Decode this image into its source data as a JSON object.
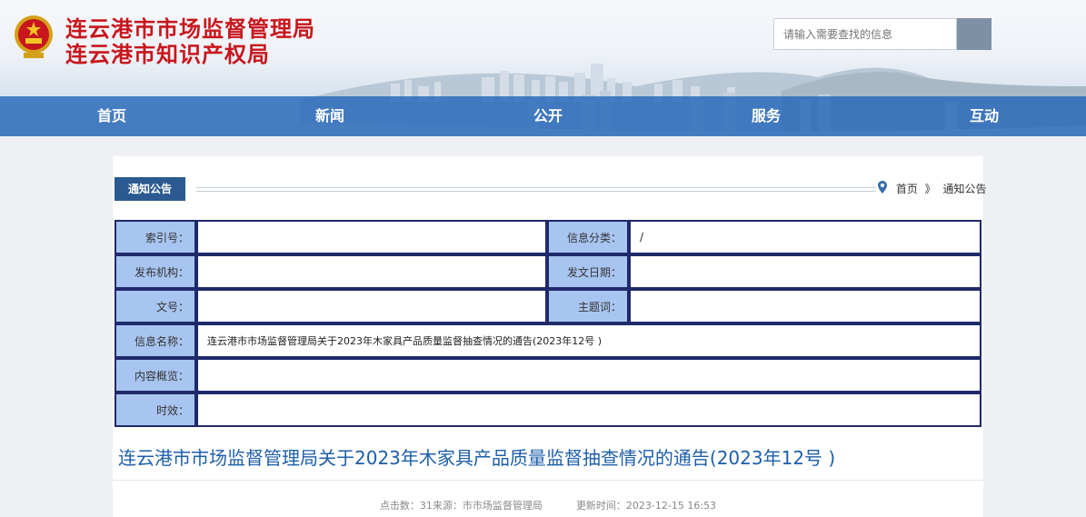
{
  "header": {
    "org_name_1": "连云港市市场监督管理局",
    "org_name_2": "连云港市知识产权局",
    "search_placeholder": "请输入需要查找的信息"
  },
  "nav": {
    "items": [
      {
        "label": "首页"
      },
      {
        "label": "新闻"
      },
      {
        "label": "公开"
      },
      {
        "label": "服务"
      },
      {
        "label": "互动"
      }
    ]
  },
  "section": {
    "tag": "通知公告",
    "breadcrumb": {
      "home": "首页",
      "separator": "》",
      "current": "通知公告"
    }
  },
  "meta": {
    "index_no_label": "索引号：",
    "index_no_value": "",
    "category_label": "信息分类：",
    "category_value": "/",
    "publisher_label": "发布机构：",
    "publisher_value": "",
    "issue_date_label": "发文日期：",
    "issue_date_value": "",
    "doc_no_label": "文号：",
    "doc_no_value": "",
    "keywords_label": "主题词：",
    "keywords_value": "",
    "info_name_label": "信息名称：",
    "info_name_value": "连云港市市场监督管理局关于2023年木家具产品质量监督抽查情况的通告(2023年12号 )",
    "summary_label": "内容概览：",
    "summary_value": "",
    "validity_label": "时效：",
    "validity_value": ""
  },
  "article": {
    "title": "连云港市市场监督管理局关于2023年木家具产品质量监督抽查情况的通告(2023年12号 )",
    "clicks_source": "点击数：31来源：市市场监督管理局",
    "updated": "更新时间：2023-12-15 16:53"
  },
  "colors": {
    "brand_red": "#c8161d",
    "nav_blue": "#2668ba",
    "tag_blue": "#2a5a8f",
    "label_bg": "#a8c4f0",
    "title_blue": "#1d5eaa"
  }
}
